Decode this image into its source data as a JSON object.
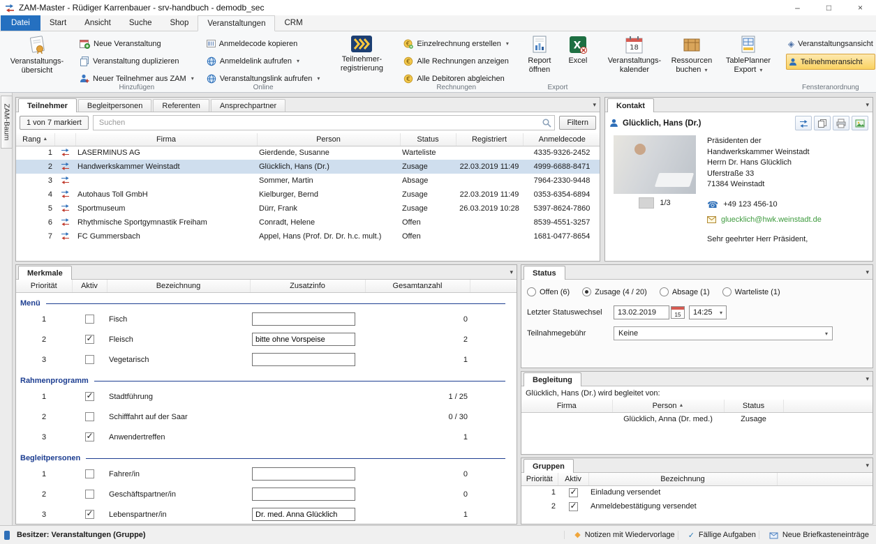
{
  "window": {
    "title": "ZAM-Master - Rüdiger Karrenbauer - srv-handbuch - demodb_sec",
    "controls": {
      "minimize": "–",
      "maximize": "□",
      "close": "×"
    }
  },
  "icons": {
    "dropdown": "▾",
    "sort_asc": "▲",
    "check": "✓",
    "diamond": "◈",
    "phone": "☎",
    "notes": "◆"
  },
  "colors": {
    "accent_blue": "#2e6fb8",
    "datei_tab_blue": "#2570c0",
    "selected_row": "#cfdeee",
    "highlight_orange": "#fad261",
    "group_header_navy": "#1d3e91",
    "email_green": "#3f9b3f"
  },
  "ribbon": {
    "tabs": [
      "Datei",
      "Start",
      "Ansicht",
      "Suche",
      "Shop",
      "Veranstaltungen",
      "CRM"
    ],
    "active_tab": "Veranstaltungen",
    "buttons": {
      "uebersicht": "Veranstaltungs-übersicht",
      "registrierung": "Teilnehmer-registrierung",
      "report": "Report öffnen",
      "excel": "Excel",
      "kalender": "Veranstaltungs-kalender",
      "ressourcen": "Ressourcen buchen",
      "tableplanner": "TablePlanner Export"
    },
    "groups": {
      "hinzufuegen": {
        "label": "Hinzufügen",
        "items": [
          "Neue Veranstaltung",
          "Veranstaltung duplizieren",
          "Neuer Teilnehmer aus ZAM"
        ]
      },
      "online": {
        "label": "Online",
        "items": [
          "Anmeldecode kopieren",
          "Anmeldelink aufrufen",
          "Veranstaltungslink aufrufen"
        ]
      },
      "rechnungen": {
        "label": "Rechnungen",
        "items": [
          "Einzelrechnung erstellen",
          "Alle Rechnungen anzeigen",
          "Alle Debitoren abgleichen"
        ]
      },
      "export": {
        "label": "Export"
      },
      "fenster": {
        "label": "Fensteranordnung",
        "items": [
          "Veranstaltungsansicht",
          "Teilnehmeransicht"
        ]
      }
    }
  },
  "zam_baum": "ZAM-Baum",
  "participants": {
    "tabs": [
      "Teilnehmer",
      "Begleitpersonen",
      "Referenten",
      "Ansprechpartner"
    ],
    "marked": "1 von 7 markiert",
    "search_placeholder": "Suchen",
    "filter_label": "Filtern",
    "columns": [
      "Rang",
      "Firma",
      "Person",
      "Status",
      "Registriert",
      "Anmeldecode"
    ],
    "rows": [
      {
        "rang": "1",
        "firma": "LASERMINUS AG",
        "person": "Gierdende, Susanne",
        "status": "Warteliste",
        "registriert": "",
        "code": "4335-9326-2452"
      },
      {
        "rang": "2",
        "firma": "Handwerkskammer Weinstadt",
        "person": "Glücklich, Hans (Dr.)",
        "status": "Zusage",
        "registriert": "22.03.2019 11:49",
        "code": "4999-6688-8471",
        "selected": true
      },
      {
        "rang": "3",
        "firma": "",
        "person": "Sommer, Martin",
        "status": "Absage",
        "registriert": "",
        "code": "7964-2330-9448"
      },
      {
        "rang": "4",
        "firma": "Autohaus Toll GmbH",
        "person": "Kielburger, Bernd",
        "status": "Zusage",
        "registriert": "22.03.2019 11:49",
        "code": "0353-6354-6894"
      },
      {
        "rang": "5",
        "firma": "Sportmuseum",
        "person": "Dürr, Frank",
        "status": "Zusage",
        "registriert": "26.03.2019 10:28",
        "code": "5397-8624-7860"
      },
      {
        "rang": "6",
        "firma": "Rhythmische Sportgymnastik Freiham",
        "person": "Conradt, Helene",
        "status": "Offen",
        "registriert": "",
        "code": "8539-4551-3257"
      },
      {
        "rang": "7",
        "firma": "FC Gummersbach",
        "person": "Appel, Hans (Prof. Dr. Dr. h.c. mult.)",
        "status": "Offen",
        "registriert": "",
        "code": "1681-0477-8654"
      }
    ]
  },
  "kontakt": {
    "tab": "Kontakt",
    "name": "Glücklich, Hans (Dr.)",
    "address": [
      "Präsidenten der",
      "Handwerkskammer Weinstadt",
      "Herrn Dr. Hans Glücklich",
      "Uferstraße 33",
      "71384 Weinstadt"
    ],
    "photo_page": "1/3",
    "phone": "+49 123 456-10",
    "email": "gluecklich@hwk.weinstadt.de",
    "salutation": "Sehr geehrter Herr Präsident,"
  },
  "merkmale": {
    "tab": "Merkmale",
    "columns": [
      "Priorität",
      "Aktiv",
      "Bezeichnung",
      "Zusatzinfo",
      "Gesamtanzahl"
    ],
    "groups": [
      {
        "name": "Menü",
        "rows": [
          {
            "prio": "1",
            "aktiv": false,
            "bezeichnung": "Fisch",
            "zusatzinfo": "",
            "gesamt": "0"
          },
          {
            "prio": "2",
            "aktiv": true,
            "bezeichnung": "Fleisch",
            "zusatzinfo": "bitte ohne Vorspeise",
            "gesamt": "2"
          },
          {
            "prio": "3",
            "aktiv": false,
            "bezeichnung": "Vegetarisch",
            "zusatzinfo": "",
            "gesamt": "1"
          }
        ]
      },
      {
        "name": "Rahmenprogramm",
        "rows": [
          {
            "prio": "1",
            "aktiv": true,
            "bezeichnung": "Stadtführung",
            "gesamt": "1  /  25"
          },
          {
            "prio": "2",
            "aktiv": false,
            "bezeichnung": "Schifffahrt auf der Saar",
            "gesamt": "0  /  30"
          },
          {
            "prio": "3",
            "aktiv": true,
            "bezeichnung": "Anwendertreffen",
            "gesamt": "1"
          }
        ]
      },
      {
        "name": "Begleitpersonen",
        "rows": [
          {
            "prio": "1",
            "aktiv": false,
            "bezeichnung": "Fahrer/in",
            "zusatzinfo": "",
            "gesamt": "0"
          },
          {
            "prio": "2",
            "aktiv": false,
            "bezeichnung": "Geschäftspartner/in",
            "zusatzinfo": "",
            "gesamt": "0"
          },
          {
            "prio": "3",
            "aktiv": true,
            "bezeichnung": "Lebenspartner/in",
            "zusatzinfo": "Dr. med. Anna Glücklich",
            "gesamt": "1"
          }
        ]
      }
    ]
  },
  "status_panel": {
    "tab": "Status",
    "radios": [
      {
        "label": "Offen (6)",
        "checked": false
      },
      {
        "label": "Zusage (4 / 20)",
        "checked": true
      },
      {
        "label": "Absage (1)",
        "checked": false
      },
      {
        "label": "Warteliste (1)",
        "checked": false
      }
    ],
    "statuswechsel_label": "Letzter Statuswechsel",
    "date": "13.02.2019",
    "date_icon_day": "15",
    "time": "14:25",
    "gebuehr_label": "Teilnahmegebühr",
    "gebuehr_value": "Keine"
  },
  "begleitung": {
    "tab": "Begleitung",
    "intro": "Glücklich, Hans (Dr.) wird begleitet von:",
    "columns": [
      "Firma",
      "Person",
      "Status"
    ],
    "rows": [
      {
        "firma": "",
        "person": "Glücklich, Anna (Dr. med.)",
        "status": "Zusage"
      }
    ]
  },
  "gruppen": {
    "tab": "Gruppen",
    "columns": [
      "Priorität",
      "Aktiv",
      "Bezeichnung"
    ],
    "rows": [
      {
        "prio": "1",
        "aktiv": true,
        "bezeichnung": "Einladung versendet"
      },
      {
        "prio": "2",
        "aktiv": true,
        "bezeichnung": "Anmeldebestätigung versendet"
      }
    ]
  },
  "statusbar": {
    "owner": "Besitzer: Veranstaltungen (Gruppe)",
    "items": [
      "Notizen mit Wiedervorlage",
      "Fällige Aufgaben",
      "Neue Briefkasteneinträge"
    ]
  }
}
